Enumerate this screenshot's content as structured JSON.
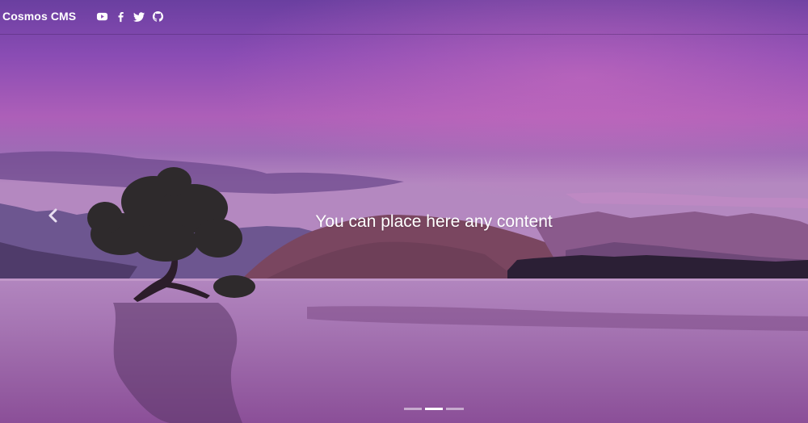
{
  "navbar": {
    "brand": "Cosmos CMS",
    "social": [
      {
        "icon": "youtube-icon"
      },
      {
        "icon": "facebook-icon"
      },
      {
        "icon": "twitter-icon"
      },
      {
        "icon": "github-icon"
      }
    ]
  },
  "carousel": {
    "caption": "You can place here any content",
    "slide_count": 3,
    "active_slide": 2,
    "prev_icon": "chevron-left-icon"
  },
  "colors": {
    "sky_top": "#6a3fa0",
    "sky_mid": "#a35ab8",
    "water": "#a266ad",
    "text": "#ffffff"
  }
}
